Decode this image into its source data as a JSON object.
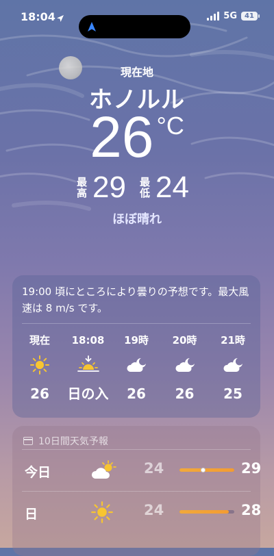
{
  "status_bar": {
    "time": "18:04",
    "network": "5G",
    "battery": "41"
  },
  "header": {
    "location_label": "現在地",
    "city": "ホノルル",
    "temperature": "26",
    "unit": "°C",
    "high_label": [
      "最",
      "高"
    ],
    "high": "29",
    "low_label": [
      "最",
      "低"
    ],
    "low": "24",
    "condition": "ほぼ晴れ"
  },
  "hourly": {
    "summary": "19:00 頃にところにより曇りの予想です。最大風速は 8 m/s です。",
    "items": [
      {
        "time": "現在",
        "icon": "sun-icon",
        "temp": "26"
      },
      {
        "time": "18:08",
        "icon": "sunset-icon",
        "temp": "日の入"
      },
      {
        "time": "19時",
        "icon": "partly-cloudy-night-icon",
        "temp": "26"
      },
      {
        "time": "20時",
        "icon": "partly-cloudy-night-icon",
        "temp": "26"
      },
      {
        "time": "21時",
        "icon": "partly-cloudy-night-icon",
        "temp": "25"
      }
    ]
  },
  "daily": {
    "title": "10日間天気予報",
    "rows": [
      {
        "day": "今日",
        "icon": "partly-sunny-icon",
        "low": "24",
        "high": "29",
        "range_start": 0.0,
        "range_end": 1.0,
        "current_position": 0.43
      },
      {
        "day": "日",
        "icon": "sun-icon",
        "low": "24",
        "high": "28",
        "range_start": 0.0,
        "range_end": 0.9
      }
    ]
  },
  "colors": {
    "bar_fill": "#f2a93b",
    "sun": "#f7c531",
    "cloud": "#ffffff"
  }
}
